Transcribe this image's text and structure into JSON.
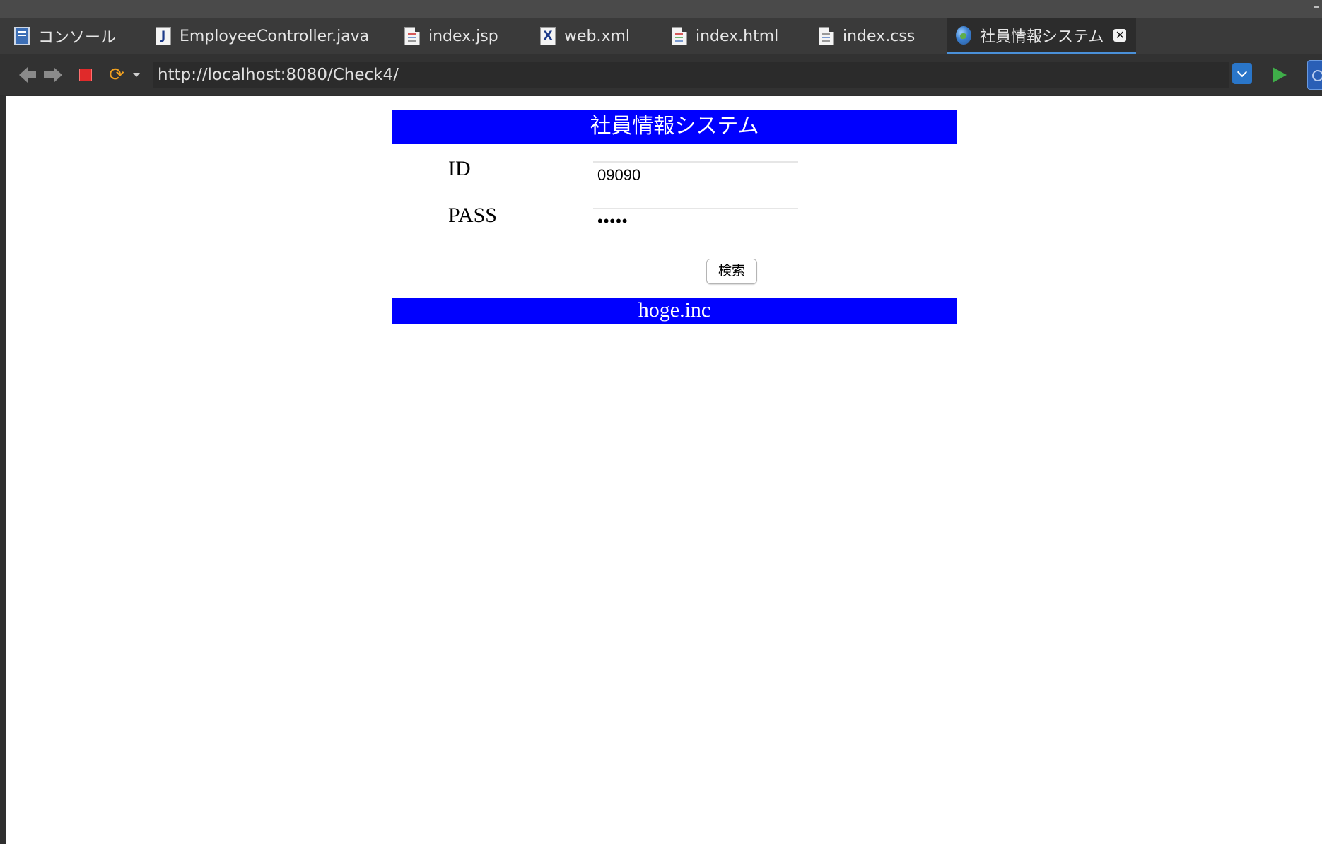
{
  "tabs": [
    {
      "label": "コンソール",
      "icon": "console-icon",
      "active": false
    },
    {
      "label": "EmployeeController.java",
      "icon": "java-file-icon",
      "active": false
    },
    {
      "label": "index.jsp",
      "icon": "jsp-file-icon",
      "active": false
    },
    {
      "label": "web.xml",
      "icon": "xml-file-icon",
      "active": false
    },
    {
      "label": "index.html",
      "icon": "html-file-icon",
      "active": false
    },
    {
      "label": "index.css",
      "icon": "css-file-icon",
      "active": true,
      "active_placeholder": false
    },
    {
      "label": "社員情報システム",
      "icon": "globe-icon",
      "active": true
    }
  ],
  "toolbar": {
    "url": "http://localhost:8080/Check4/",
    "close_glyph": "✕"
  },
  "page": {
    "header_title": "社員情報システム",
    "id_label": "ID",
    "id_value": "09090",
    "pass_label": "PASS",
    "pass_value": "•••••",
    "search_button": "検索",
    "footer_text": "hoge.inc"
  },
  "colors": {
    "banner_blue": "#0000ff",
    "tab_active_underline": "#4a90d9",
    "stop_red": "#e02a2a",
    "go_green": "#3fae49"
  }
}
